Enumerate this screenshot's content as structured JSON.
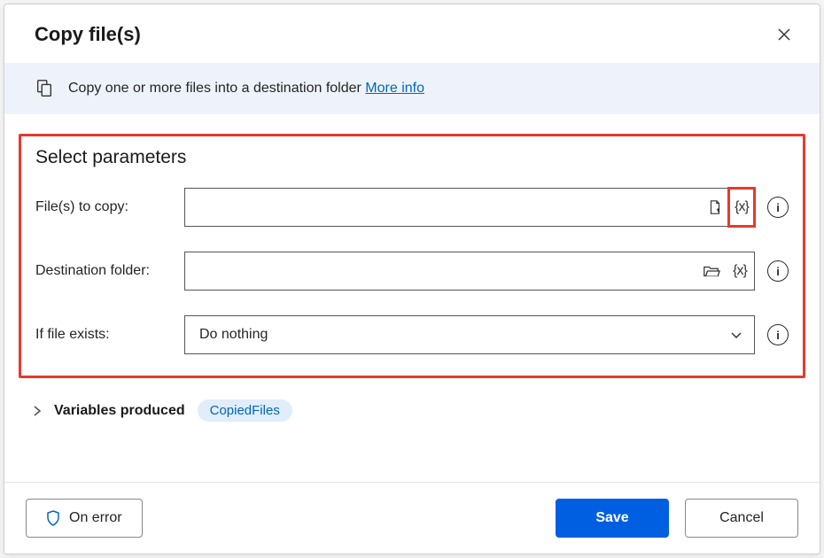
{
  "dialog": {
    "title": "Copy file(s)"
  },
  "banner": {
    "text": "Copy one or more files into a destination folder ",
    "link": "More info"
  },
  "params": {
    "section_title": "Select parameters",
    "files_to_copy": {
      "label": "File(s) to copy:",
      "value": ""
    },
    "destination": {
      "label": "Destination folder:",
      "value": ""
    },
    "if_exists": {
      "label": "If file exists:",
      "selected": "Do nothing"
    }
  },
  "variables": {
    "label": "Variables produced",
    "items": [
      "CopiedFiles"
    ]
  },
  "footer": {
    "on_error": "On error",
    "save": "Save",
    "cancel": "Cancel"
  },
  "glyphs": {
    "var_token": "{x}"
  }
}
